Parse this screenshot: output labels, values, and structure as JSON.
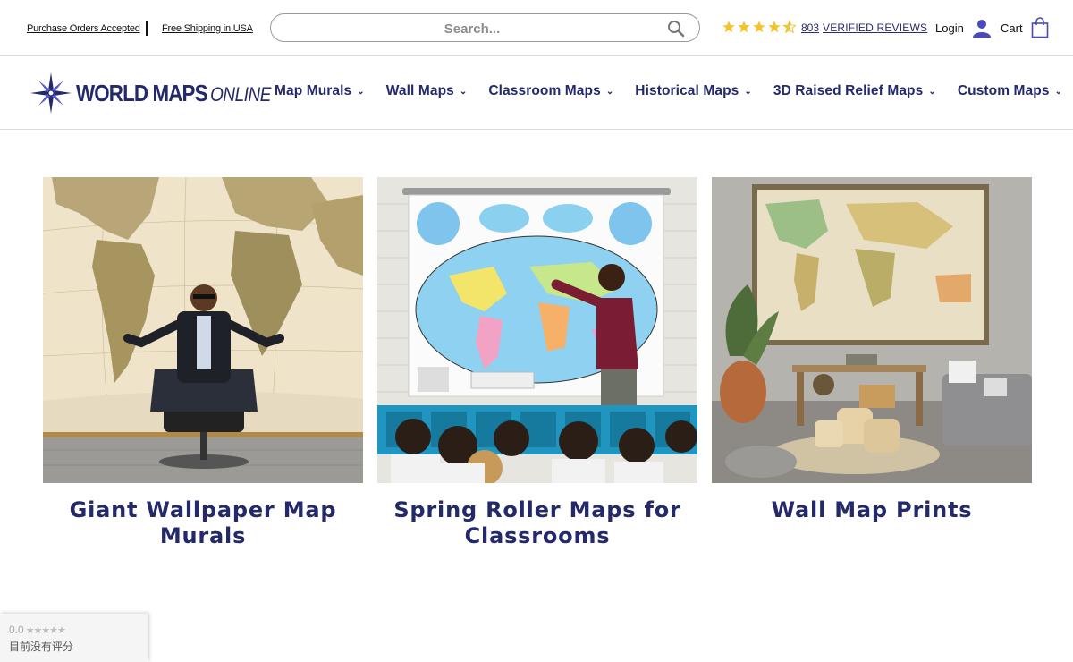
{
  "topbar": {
    "promo_1": "Purchase Orders Accepted",
    "promo_2": "Free Shipping in USA",
    "search_placeholder": "Search...",
    "rating_stars": 4.5,
    "review_count": "803",
    "review_label": "VERIFIED REVIEWS",
    "login_label": "Login",
    "cart_label": "Cart"
  },
  "logo": {
    "name_main": "WORLD MAPS",
    "name_sub": "ONLINE"
  },
  "nav": {
    "items": [
      {
        "label": "Map Murals"
      },
      {
        "label": "Wall Maps"
      },
      {
        "label": "Classroom Maps"
      },
      {
        "label": "Historical Maps"
      },
      {
        "label": "3D Raised Relief Maps"
      },
      {
        "label": "Custom Maps"
      }
    ]
  },
  "cards": [
    {
      "title": "Giant Wallpaper Map Murals"
    },
    {
      "title": "Spring Roller Maps for Classrooms"
    },
    {
      "title": "Wall Map Prints"
    }
  ],
  "rating_widget": {
    "score": "0.0",
    "stars": "★★★★★",
    "text": "目前没有评分"
  },
  "colors": {
    "brand_navy": "#23296b",
    "star_gold": "#f4c430",
    "icon_blue": "#4a4ab8"
  }
}
